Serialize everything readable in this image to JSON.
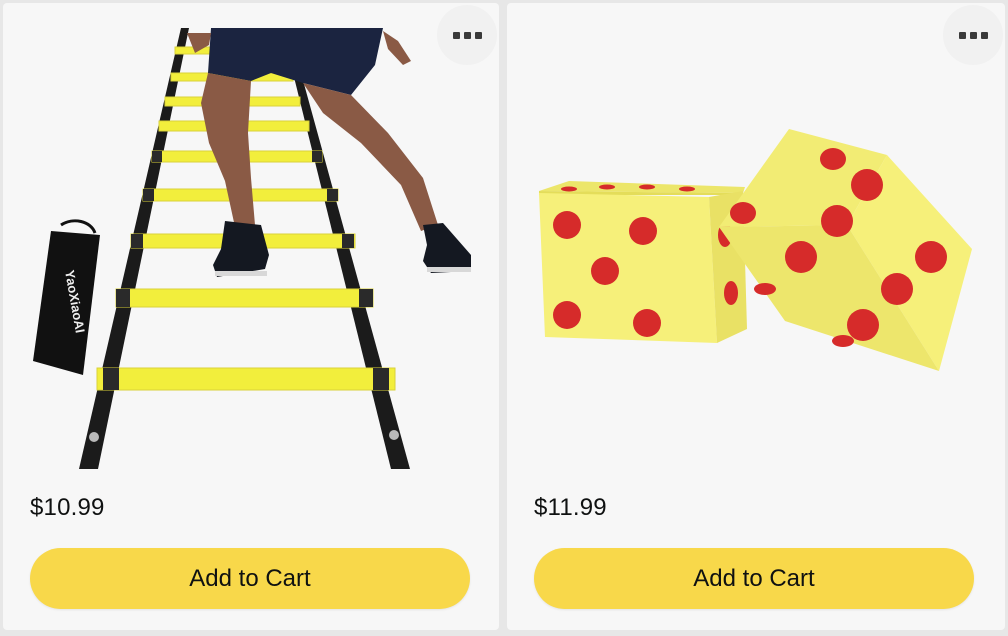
{
  "products": [
    {
      "image_alt": "Agility ladder",
      "bag_text": "YaoXiaoAI",
      "price": "$10.99",
      "cart_label": "Add to Cart",
      "more_icon": "more-options-icon"
    },
    {
      "image_alt": "Jumbo foam dice",
      "price": "$11.99",
      "cart_label": "Add to Cart",
      "more_icon": "more-options-icon"
    }
  ],
  "colors": {
    "button": "#f8d84a",
    "ladder_rung": "#f2ee3c",
    "dice_face": "#f6f07a",
    "dice_pip": "#d62b2a"
  }
}
